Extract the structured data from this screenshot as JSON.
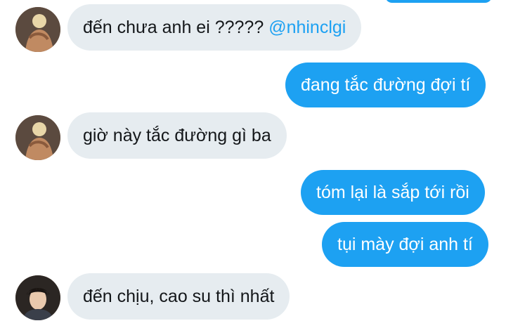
{
  "messages": [
    {
      "direction": "incoming",
      "avatar": "person-a-photo",
      "text": "đến chưa anh ei ?????",
      "mention": "@nhinclgi"
    },
    {
      "direction": "outgoing",
      "text": "đang tắc đường đợi tí"
    },
    {
      "direction": "incoming",
      "avatar": "person-a-photo",
      "text": "giờ này tắc đường gì ba"
    },
    {
      "direction": "outgoing",
      "text": "tóm lại là sắp tới rồi"
    },
    {
      "direction": "outgoing",
      "text": "tụi mày đợi anh tí"
    },
    {
      "direction": "incoming",
      "avatar": "person-b-photo",
      "text": "đến chịu, cao su thì nhất"
    }
  ],
  "colors": {
    "outgoing_bubble": "#1da1f2",
    "incoming_bubble": "#e6ecf0",
    "mention": "#1da1f2"
  }
}
